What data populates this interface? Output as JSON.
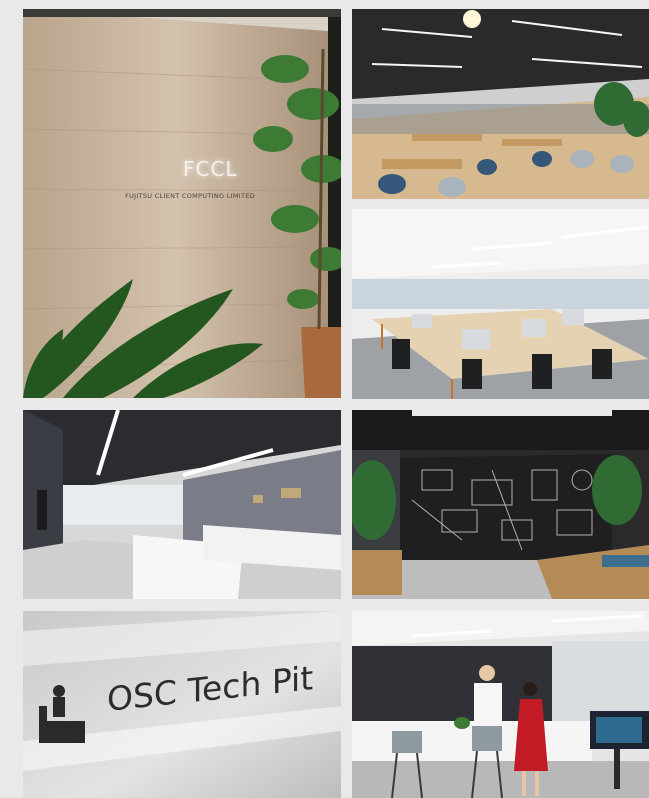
{
  "collage": {
    "tiles": [
      {
        "name": "reception-wall-photo",
        "sign_text": "FCCL",
        "sign_subtext": "FUJITSU CLIENT COMPUTING LIMITED"
      },
      {
        "name": "open-office-lounge-photo"
      },
      {
        "name": "office-desks-photo"
      },
      {
        "name": "showroom-corridor-photo"
      },
      {
        "name": "illustrated-wall-lounge-photo"
      },
      {
        "name": "tech-pit-sign-photo",
        "sign_text": "OSC Tech Pit"
      },
      {
        "name": "service-counter-photo"
      }
    ]
  },
  "colors": {
    "background": "#e9e9e9",
    "wood": "#cbb7a0",
    "foliage": "#2f6b32",
    "dark_ceiling": "#2a2a2a"
  }
}
